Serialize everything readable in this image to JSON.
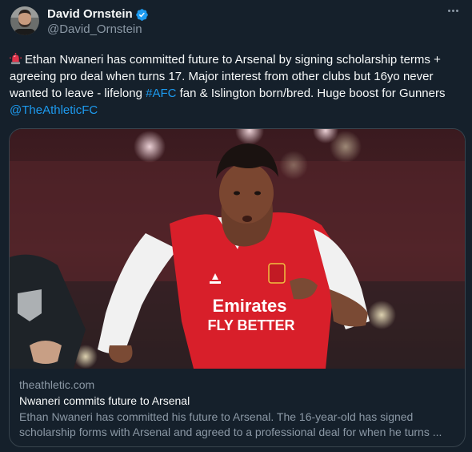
{
  "author": {
    "name": "David Ornstein",
    "handle": "@David_Ornstein",
    "avatar_icon": "profile-photo",
    "verified_icon": "verified-badge-icon"
  },
  "menu": {
    "icon": "more-options-icon"
  },
  "tweet": {
    "emoji": "rotating-light-emoji",
    "text_part1": "Ethan Nwaneri has committed future to Arsenal by signing scholarship terms + agreeing pro deal when turns 17. Major interest from other clubs but 16yo never wanted to leave - lifelong ",
    "hashtag": "#AFC",
    "text_part2": " fan & Islington born/bred. Huge boost for Gunners ",
    "mention": "@TheAthleticFC"
  },
  "card": {
    "image_alt": "Ethan Nwaneri in Arsenal shirt",
    "shirt_sponsor_line1": "Emirates",
    "shirt_sponsor_line2": "FLY BETTER",
    "domain": "theathletic.com",
    "title": "Nwaneri commits future to Arsenal",
    "description": "Ethan Nwaneri has committed his future to Arsenal. The 16-year-old has signed scholarship forms with Arsenal and agreed to a professional deal for when he turns ..."
  },
  "colors": {
    "background": "#15202b",
    "accent": "#1d9bf0",
    "secondary_text": "#8b98a5",
    "border": "#38444d"
  }
}
